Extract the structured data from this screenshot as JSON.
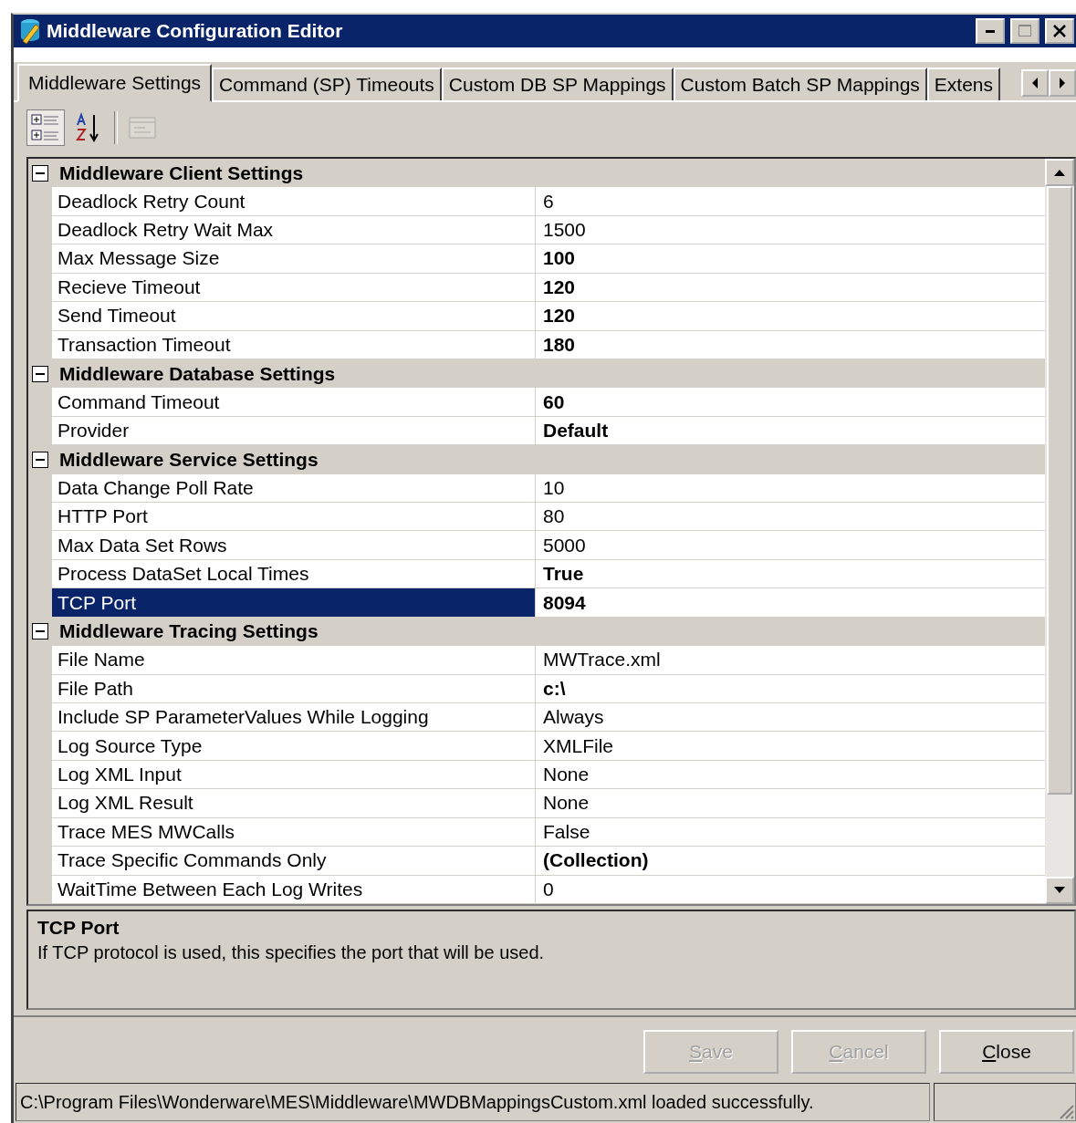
{
  "window": {
    "title": "Middleware Configuration Editor"
  },
  "tabs": [
    {
      "label": "Middleware Settings",
      "selected": true
    },
    {
      "label": "Command (SP) Timeouts",
      "selected": false
    },
    {
      "label": "Custom DB SP Mappings",
      "selected": false
    },
    {
      "label": "Custom Batch SP Mappings",
      "selected": false
    },
    {
      "label": "Extens",
      "selected": false
    }
  ],
  "toolbar": [
    {
      "kind": "categorized",
      "selected": true,
      "disabled": false
    },
    {
      "kind": "alphabetical",
      "selected": false,
      "disabled": false
    },
    {
      "kind": "property-pages",
      "selected": false,
      "disabled": true
    }
  ],
  "grid": {
    "categories": [
      {
        "name": "Middleware Client Settings",
        "expanded": true,
        "properties": [
          {
            "name": "Deadlock Retry Count",
            "value": "6",
            "modified": false,
            "selected": false
          },
          {
            "name": "Deadlock Retry Wait Max",
            "value": "1500",
            "modified": false,
            "selected": false
          },
          {
            "name": "Max Message Size",
            "value": "100",
            "modified": true,
            "selected": false
          },
          {
            "name": "Recieve Timeout",
            "value": "120",
            "modified": true,
            "selected": false
          },
          {
            "name": "Send Timeout",
            "value": "120",
            "modified": true,
            "selected": false
          },
          {
            "name": "Transaction Timeout",
            "value": "180",
            "modified": true,
            "selected": false
          }
        ]
      },
      {
        "name": "Middleware Database Settings",
        "expanded": true,
        "properties": [
          {
            "name": "Command Timeout",
            "value": "60",
            "modified": true,
            "selected": false
          },
          {
            "name": "Provider",
            "value": "Default",
            "modified": true,
            "selected": false
          }
        ]
      },
      {
        "name": "Middleware Service Settings",
        "expanded": true,
        "properties": [
          {
            "name": "Data Change Poll Rate",
            "value": "10",
            "modified": false,
            "selected": false
          },
          {
            "name": "HTTP Port",
            "value": "80",
            "modified": false,
            "selected": false
          },
          {
            "name": "Max Data Set Rows",
            "value": "5000",
            "modified": false,
            "selected": false
          },
          {
            "name": "Process DataSet Local Times",
            "value": "True",
            "modified": true,
            "selected": false
          },
          {
            "name": "TCP Port",
            "value": "8094",
            "modified": true,
            "selected": true
          }
        ]
      },
      {
        "name": "Middleware Tracing Settings",
        "expanded": true,
        "properties": [
          {
            "name": "File Name",
            "value": "MWTrace.xml",
            "modified": false,
            "selected": false
          },
          {
            "name": "File Path",
            "value": "c:\\",
            "modified": true,
            "selected": false
          },
          {
            "name": "Include SP ParameterValues While Logging",
            "value": "Always",
            "modified": false,
            "selected": false
          },
          {
            "name": "Log Source Type",
            "value": "XMLFile",
            "modified": false,
            "selected": false
          },
          {
            "name": "Log XML Input",
            "value": "None",
            "modified": false,
            "selected": false
          },
          {
            "name": "Log XML Result",
            "value": "None",
            "modified": false,
            "selected": false
          },
          {
            "name": "Trace MES MWCalls",
            "value": "False",
            "modified": false,
            "selected": false
          },
          {
            "name": "Trace Specific Commands Only",
            "value": "(Collection)",
            "modified": true,
            "selected": false
          },
          {
            "name": "WaitTime Between Each Log Writes",
            "value": "0",
            "modified": false,
            "selected": false
          }
        ]
      }
    ]
  },
  "description": {
    "title": "TCP Port",
    "text": "If TCP protocol is used, this specifies the port that will be used."
  },
  "buttons": [
    {
      "label": "Save",
      "mnemonic": true,
      "disabled": true
    },
    {
      "label": "Cancel",
      "mnemonic": true,
      "disabled": true
    },
    {
      "label": "Close",
      "mnemonic": true,
      "disabled": false
    }
  ],
  "status_bar": {
    "text": "C:\\Program Files\\Wonderware\\MES\\Middleware\\MWDBMappingsCustom.xml loaded successfully."
  }
}
